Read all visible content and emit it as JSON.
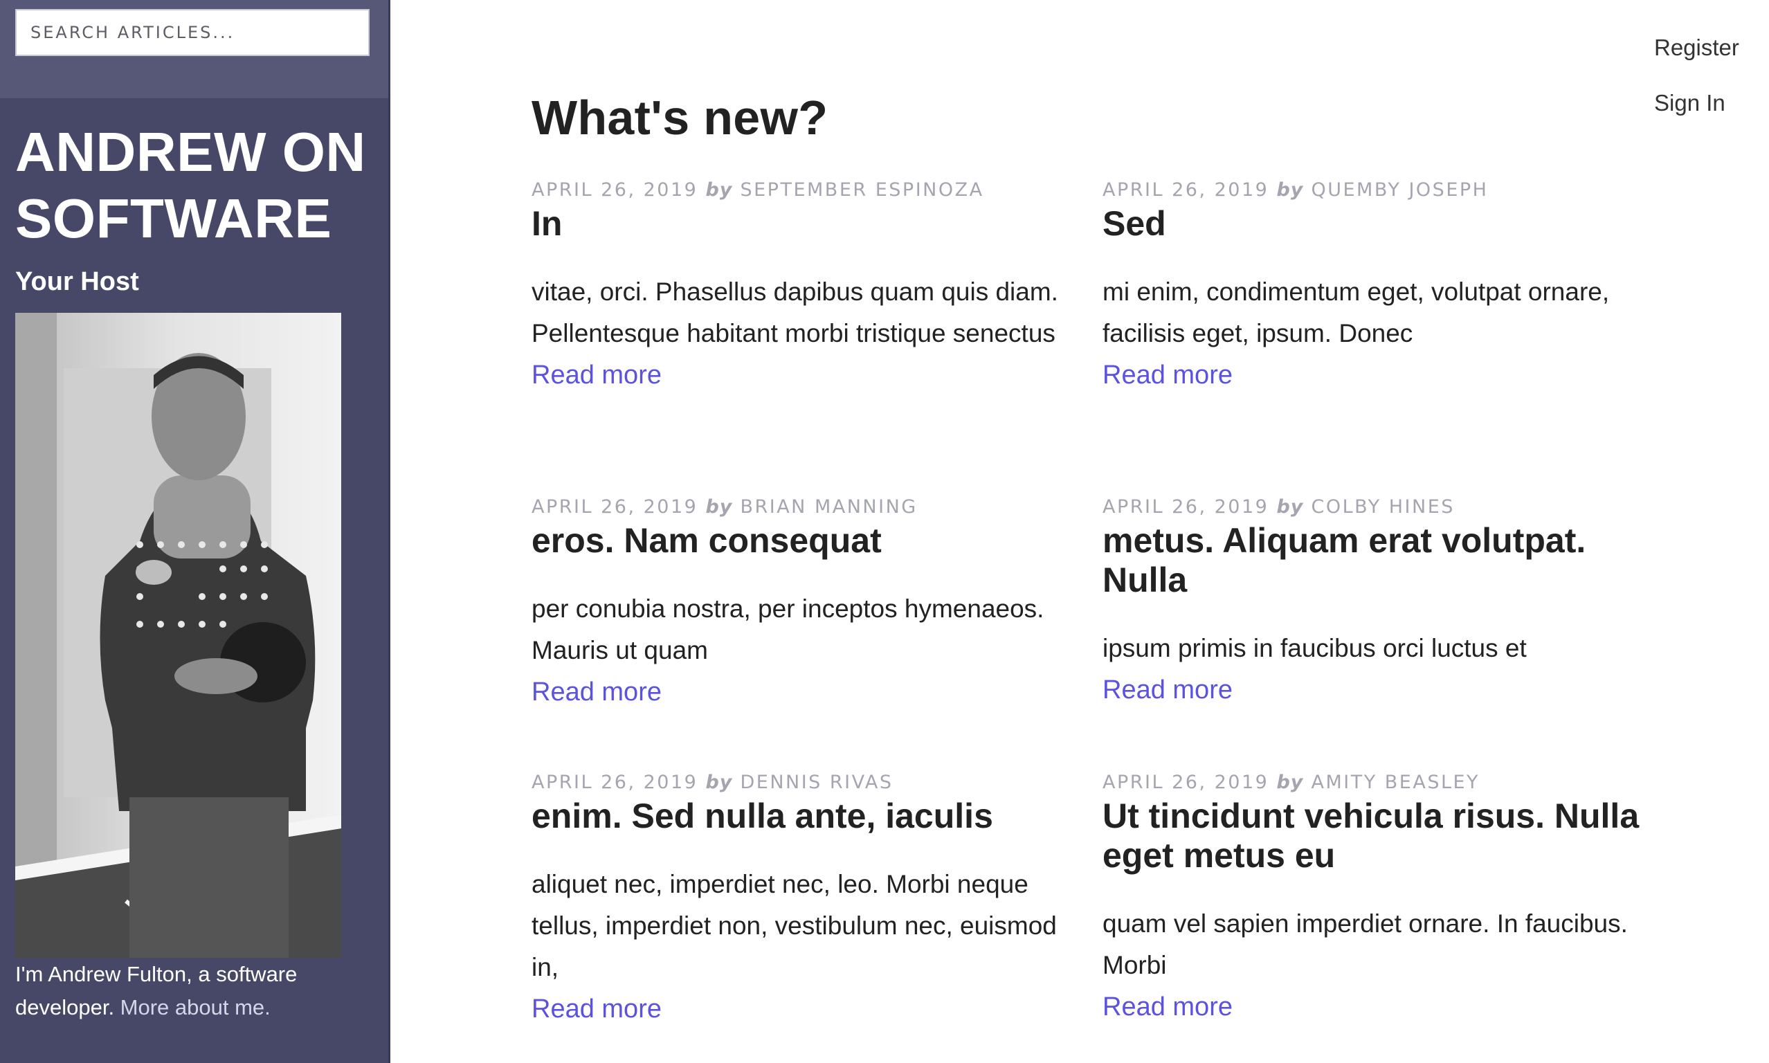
{
  "search": {
    "placeholder": "SEARCH ARTICLES..."
  },
  "sidebar": {
    "site_title": "ANDREW ON SOFTWARE",
    "host_heading": "Your Host",
    "bio_text": "I'm Andrew Fulton, a software developer. ",
    "bio_link": "More about me."
  },
  "nav": {
    "register": "Register",
    "sign_in": "Sign In"
  },
  "main": {
    "heading": "What's new?",
    "by_word": "by",
    "read_more": "Read more",
    "articles": [
      {
        "date": "APRIL 26, 2019",
        "author": "SEPTEMBER ESPINOZA",
        "title": "In",
        "excerpt": "vitae, orci. Phasellus dapibus quam quis diam. Pellentesque habitant morbi tristique senectus"
      },
      {
        "date": "APRIL 26, 2019",
        "author": "QUEMBY JOSEPH",
        "title": "Sed",
        "excerpt": "mi enim, condimentum eget, volutpat ornare, facilisis eget, ipsum. Donec"
      },
      {
        "date": "APRIL 26, 2019",
        "author": "BRIAN MANNING",
        "title": "eros. Nam consequat",
        "excerpt": "per conubia nostra, per inceptos hymenaeos. Mauris ut quam"
      },
      {
        "date": "APRIL 26, 2019",
        "author": "COLBY HINES",
        "title": "metus. Aliquam erat volutpat. Nulla",
        "excerpt": "ipsum primis in faucibus orci luctus et"
      },
      {
        "date": "APRIL 26, 2019",
        "author": "DENNIS RIVAS",
        "title": "enim. Sed nulla ante, iaculis",
        "excerpt": "aliquet nec, imperdiet nec, leo. Morbi neque tellus, imperdiet non, vestibulum nec, euismod in,"
      },
      {
        "date": "APRIL 26, 2019",
        "author": "AMITY BEASLEY",
        "title": "Ut tincidunt vehicula risus. Nulla eget metus eu",
        "excerpt": "quam vel sapien imperdiet ornare. In faucibus. Morbi"
      }
    ]
  },
  "colors": {
    "sidebar_bg": "#474867",
    "search_band_bg": "#575877",
    "link_accent": "#5b52e0",
    "meta_gray": "#a5a5b0",
    "text_dark": "#222222"
  }
}
